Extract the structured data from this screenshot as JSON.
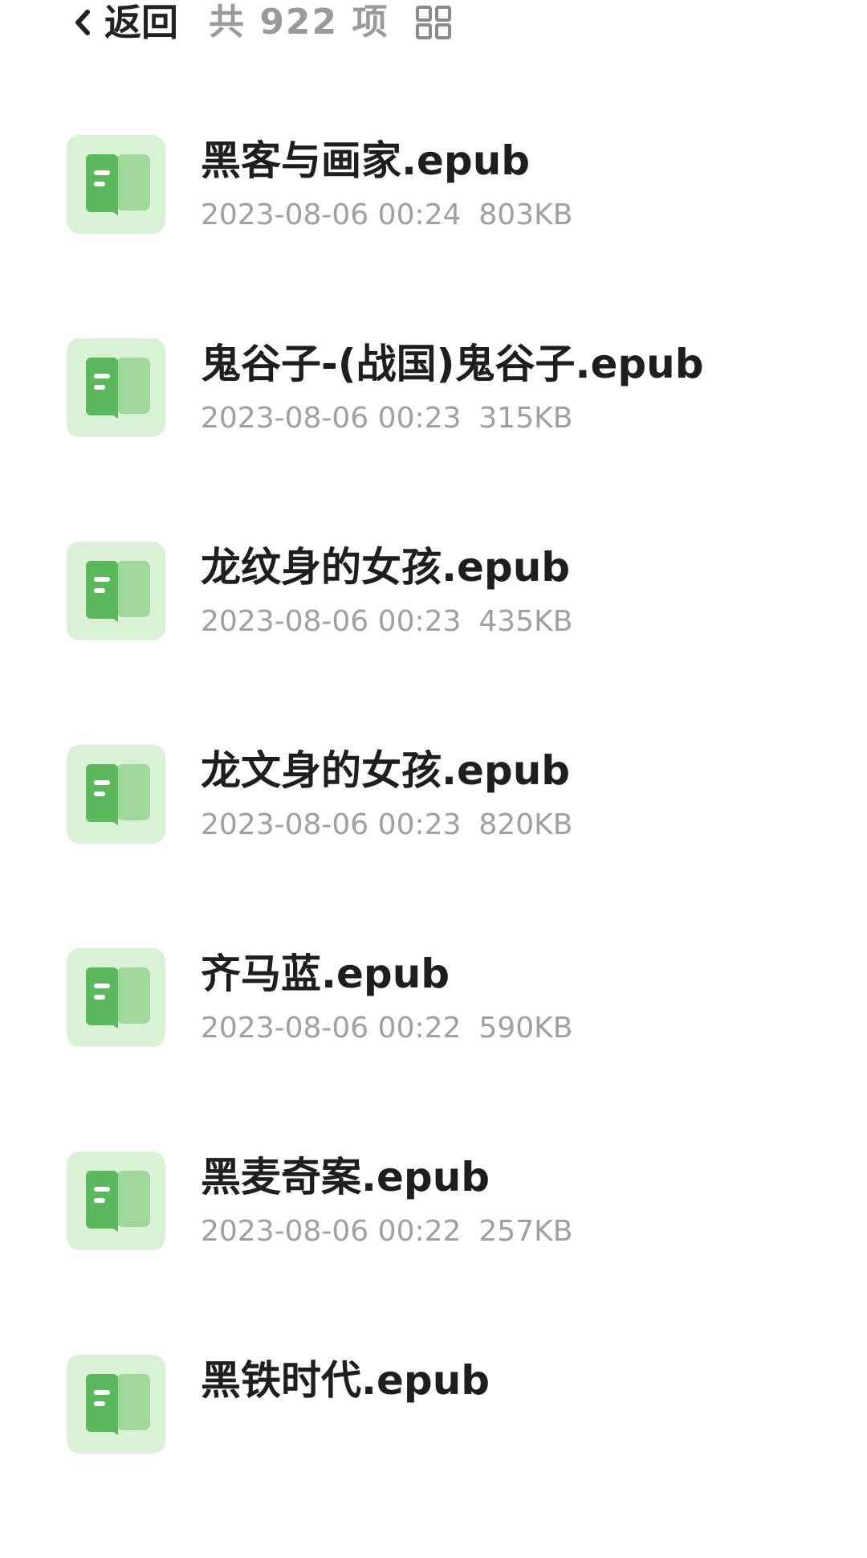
{
  "header": {
    "back_label": "返回",
    "item_count": "共 922 项"
  },
  "files": [
    {
      "name": "黑客与画家.epub",
      "date": "2023-08-06 00:24",
      "size": "803KB"
    },
    {
      "name": "鬼谷子-(战国)鬼谷子.epub",
      "date": "2023-08-06 00:23",
      "size": "315KB"
    },
    {
      "name": "龙纹身的女孩.epub",
      "date": "2023-08-06 00:23",
      "size": "435KB"
    },
    {
      "name": "龙文身的女孩.epub",
      "date": "2023-08-06 00:23",
      "size": "820KB"
    },
    {
      "name": "齐马蓝.epub",
      "date": "2023-08-06 00:22",
      "size": "590KB"
    },
    {
      "name": "黑麦奇案.epub",
      "date": "2023-08-06 00:22",
      "size": "257KB"
    },
    {
      "name": "黑铁时代.epub",
      "date": "",
      "size": ""
    }
  ],
  "colors": {
    "icon_bg": "#d9f2d6",
    "icon_book": "#5cb85c",
    "name_text": "#1e1e1e",
    "meta_text": "#a0a0a0"
  },
  "icons": {
    "back": "chevron-left-icon",
    "view": "grid-view-icon",
    "file": "book-icon"
  }
}
